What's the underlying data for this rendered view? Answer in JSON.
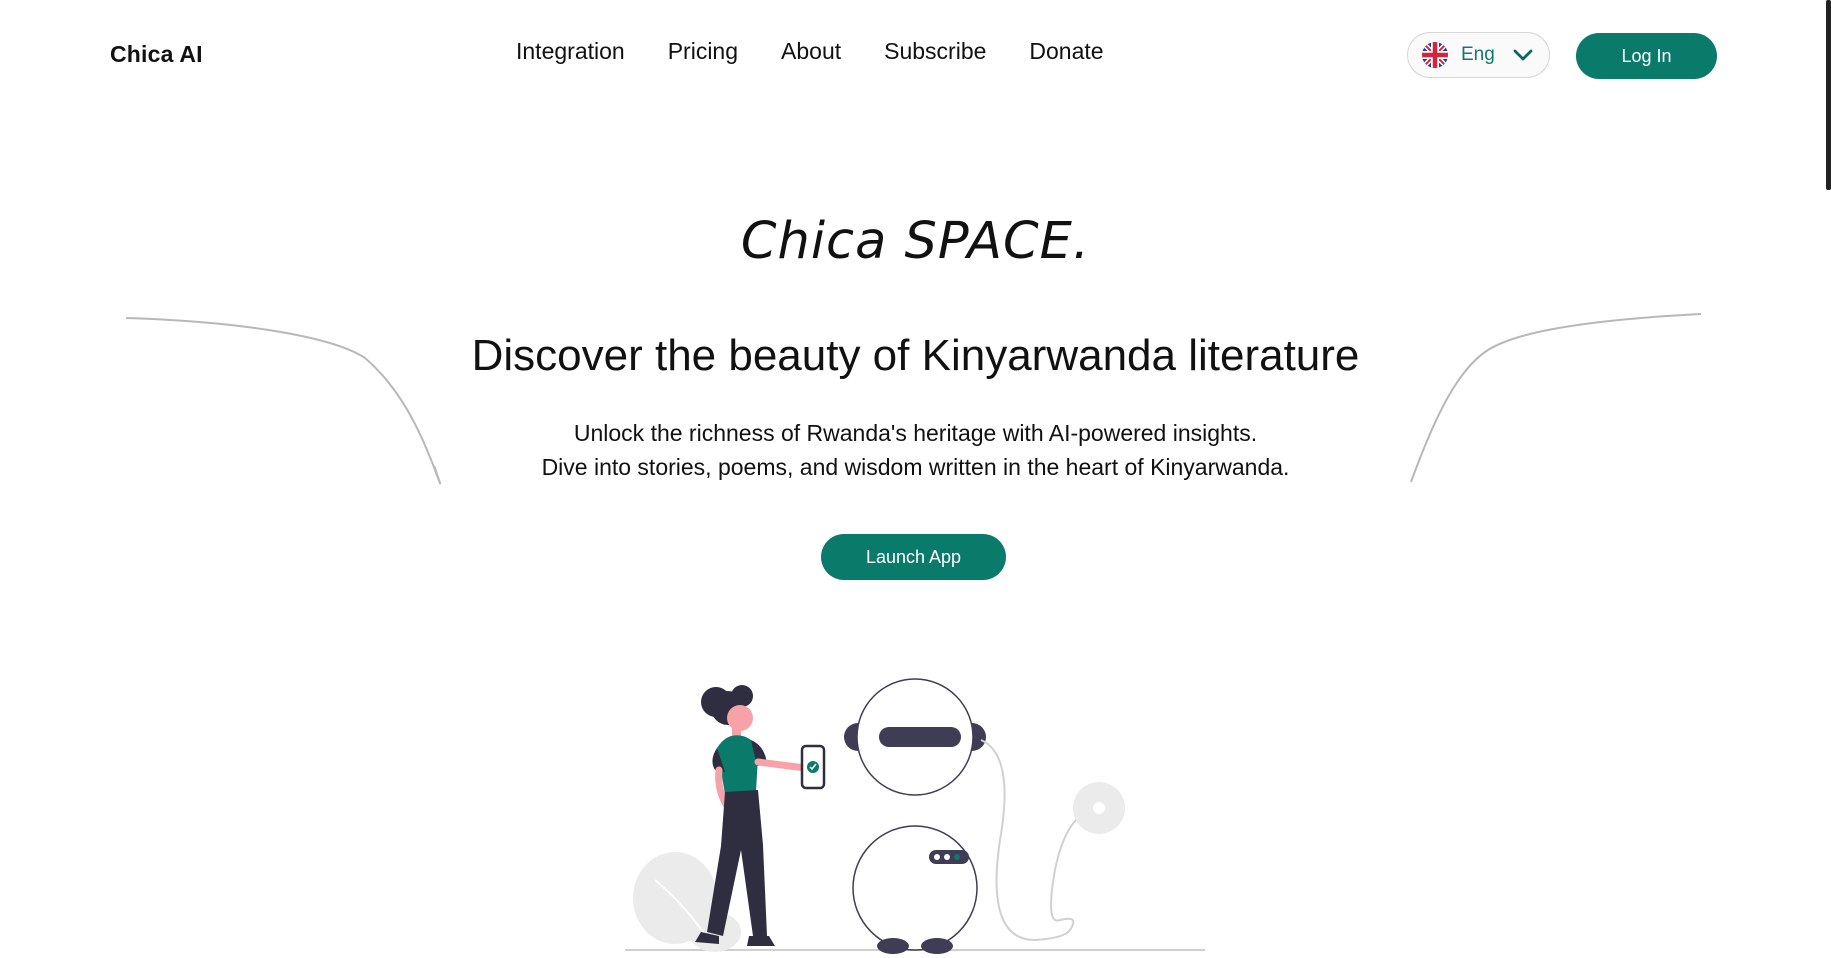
{
  "header": {
    "logo": "Chica AI",
    "nav": [
      "Integration",
      "Pricing",
      "About",
      "Subscribe",
      "Donate"
    ],
    "language": {
      "label": "Eng",
      "flag_icon": "uk-flag-icon",
      "dropdown_icon": "chevron-down-icon"
    },
    "login_label": "Log In"
  },
  "hero": {
    "title": "Chica SPACE.",
    "heading": "Discover the beauty of Kinyarwanda literature",
    "subtitle_line1": "Unlock the richness of Rwanda's heritage with AI-powered insights.",
    "subtitle_line2": "Dive into stories, poems, and wisdom written in the heart of Kinyarwanda.",
    "cta_label": "Launch App"
  },
  "illustration": {
    "description_icon": "woman-and-robot-illustration"
  },
  "colors": {
    "accent": "#0a7a6b",
    "text": "#111111",
    "background": "#ffffff"
  }
}
